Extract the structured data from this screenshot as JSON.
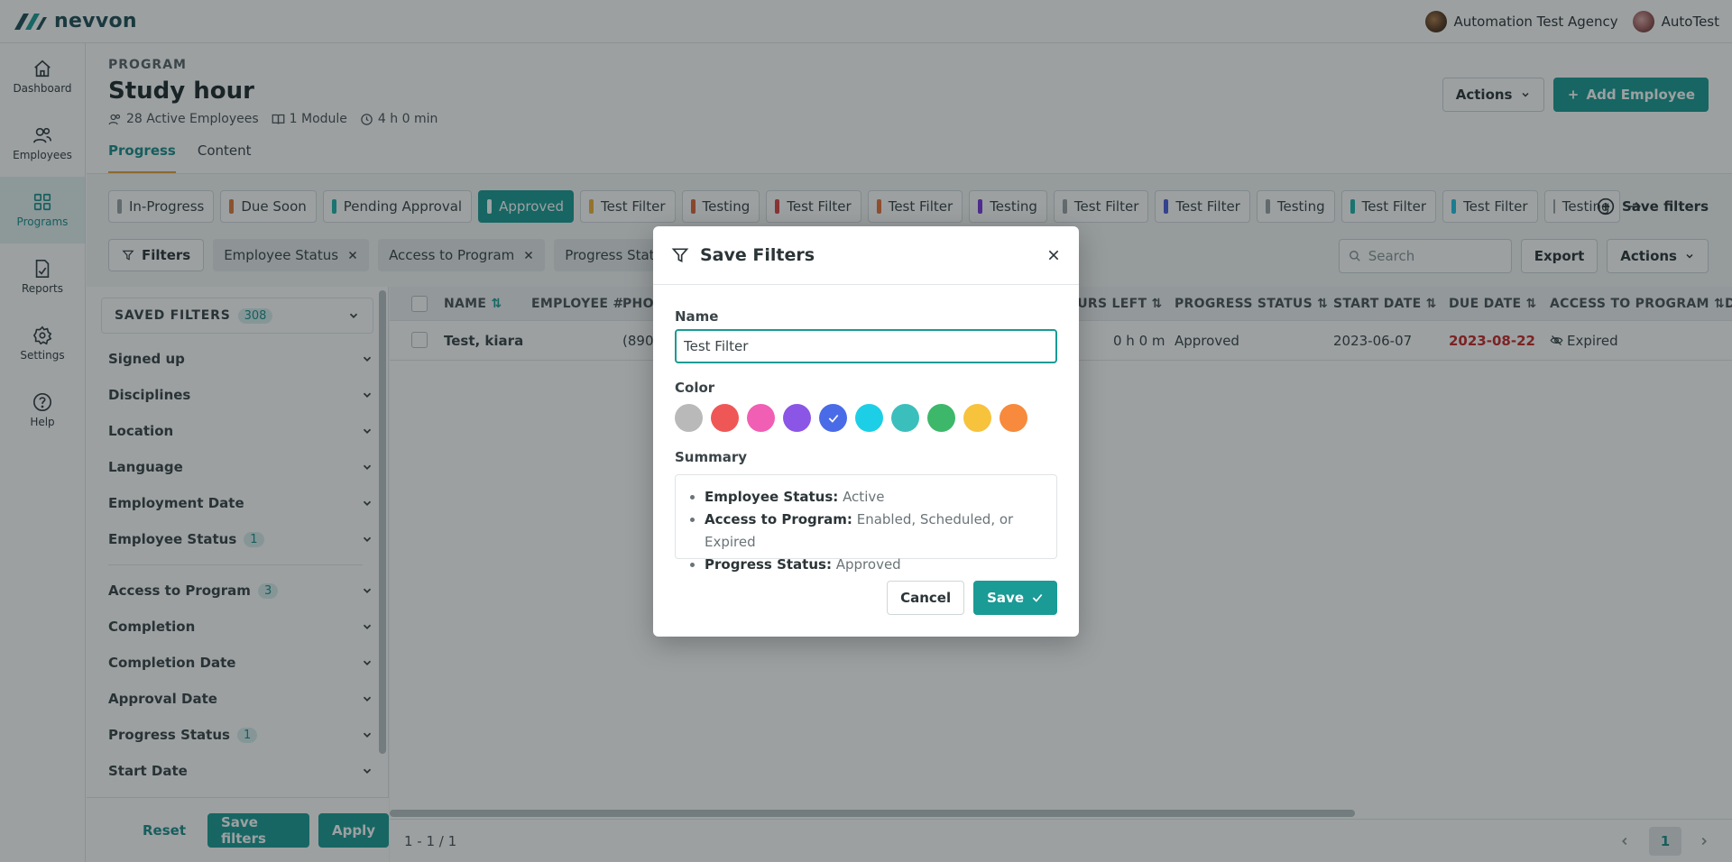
{
  "app": {
    "brand": "nevvon"
  },
  "topbar": {
    "agency": "Automation Test Agency",
    "user": "AutoTest"
  },
  "nav": [
    {
      "label": "Dashboard",
      "icon": "home-icon"
    },
    {
      "label": "Employees",
      "icon": "users-icon"
    },
    {
      "label": "Programs",
      "icon": "grid-icon",
      "active": true
    },
    {
      "label": "Reports",
      "icon": "report-icon"
    },
    {
      "label": "Settings",
      "icon": "gear-icon"
    },
    {
      "label": "Help",
      "icon": "help-icon"
    }
  ],
  "header": {
    "kicker": "PROGRAM",
    "title": "Study hour",
    "employees": "28 Active Employees",
    "modules": "1 Module",
    "duration": "4 h 0 min",
    "tabs": [
      "Progress",
      "Content"
    ],
    "actions_label": "Actions",
    "add_label": "Add Employee"
  },
  "chips": [
    {
      "label": "In-Progress",
      "color": "#9aa3a6"
    },
    {
      "label": "Due Soon",
      "color": "#e07a3a"
    },
    {
      "label": "Pending Approval",
      "color": "#1fb3ad"
    },
    {
      "label": "Approved",
      "color": "#ffffff",
      "selected": true
    },
    {
      "label": "Test Filter",
      "color": "#f0b43a"
    },
    {
      "label": "Testing",
      "color": "#e0643a"
    },
    {
      "label": "Test Filter",
      "color": "#e04444"
    },
    {
      "label": "Test Filter",
      "color": "#e8743a"
    },
    {
      "label": "Testing",
      "color": "#7a3ae0"
    },
    {
      "label": "Test Filter",
      "color": "#9aa3a6"
    },
    {
      "label": "Test Filter",
      "color": "#4a5fe0"
    },
    {
      "label": "Testing",
      "color": "#9aa3a6"
    },
    {
      "label": "Test Filter",
      "color": "#1fb3ad"
    },
    {
      "label": "Test Filter",
      "color": "#22c3e0"
    },
    {
      "label": "Testing",
      "color": "#9aa3a6"
    }
  ],
  "save_filters_link": "Save filters",
  "filterbar": {
    "filters_label": "Filters",
    "pills": [
      "Employee Status",
      "Access to Program",
      "Progress Status"
    ],
    "search_placeholder": "Search",
    "export_label": "Export",
    "actions_label": "Actions"
  },
  "panel": {
    "title": "SAVED FILTERS",
    "count": "308",
    "items": [
      {
        "label": "Signed up"
      },
      {
        "label": "Disciplines"
      },
      {
        "label": "Location"
      },
      {
        "label": "Language"
      },
      {
        "label": "Employment Date"
      },
      {
        "label": "Employee Status",
        "badge": "1"
      },
      {
        "label": "Access to Program",
        "badge": "3"
      },
      {
        "label": "Completion"
      },
      {
        "label": "Completion Date"
      },
      {
        "label": "Approval Date"
      },
      {
        "label": "Progress Status",
        "badge": "1"
      },
      {
        "label": "Start Date"
      }
    ],
    "reset": "Reset",
    "save_filters": "Save filters",
    "apply": "Apply"
  },
  "table": {
    "headers": [
      "NAME",
      "EMPLOYEE #",
      "PHO",
      "OURS LEFT",
      "PROGRESS STATUS",
      "START DATE",
      "DUE DATE",
      "ACCESS TO PROGRAM",
      "D"
    ],
    "row": {
      "name": "Test, kiara",
      "phone": "(890",
      "hours_left": "0 h 0 m",
      "progress_status": "Approved",
      "start_date": "2023-06-07",
      "due_date": "2023-08-22",
      "access": "Expired"
    },
    "pager_text": "1 - 1 / 1",
    "page": "1"
  },
  "modal": {
    "title": "Save Filters",
    "name_label": "Name",
    "name_value": "Test Filter",
    "color_label": "Color",
    "colors": [
      "#b9b9b9",
      "#ef5757",
      "#f05fb3",
      "#8b55e6",
      "#4a6be8",
      "#1ccfe6",
      "#3bbfbd",
      "#3db86a",
      "#f7c23c",
      "#f78a3c"
    ],
    "selected_color_index": 4,
    "summary_label": "Summary",
    "summary": [
      {
        "key": "Employee Status:",
        "value": "Active"
      },
      {
        "key": "Access to Program:",
        "value": "Enabled, Scheduled, or Expired"
      },
      {
        "key": "Progress Status:",
        "value": "Approved"
      }
    ],
    "cancel_label": "Cancel",
    "save_label": "Save"
  }
}
